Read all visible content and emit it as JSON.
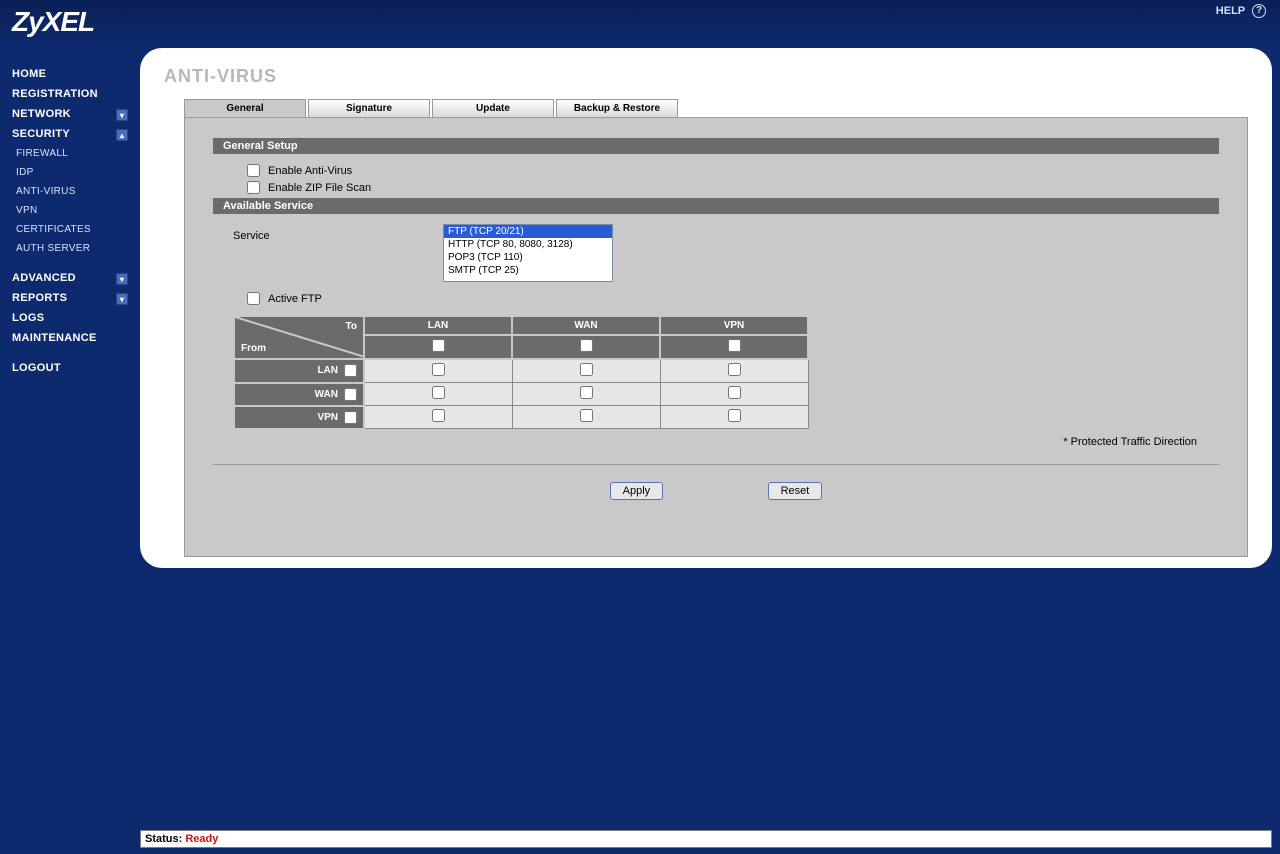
{
  "brand": "ZyXEL",
  "help_label": "HELP",
  "page_title": "ANTI-VIRUS",
  "nav": {
    "home": "HOME",
    "registration": "REGISTRATION",
    "network": "NETWORK",
    "security": "SECURITY",
    "firewall": "FIREWALL",
    "idp": "IDP",
    "antivirus": "ANTI-VIRUS",
    "vpn": "VPN",
    "certificates": "CERTIFICATES",
    "authserver": "AUTH SERVER",
    "advanced": "ADVANCED",
    "reports": "REPORTS",
    "logs": "LOGS",
    "maintenance": "MAINTENANCE",
    "logout": "LOGOUT"
  },
  "tabs": {
    "general": "General",
    "signature": "Signature",
    "update": "Update",
    "backup": "Backup & Restore"
  },
  "sections": {
    "general_setup": "General Setup",
    "available_service": "Available Service"
  },
  "checkboxes": {
    "enable_av": "Enable Anti-Virus",
    "enable_zip": "Enable ZIP File Scan",
    "active_ftp": "Active FTP"
  },
  "labels": {
    "service": "Service",
    "to": "To",
    "from": "From"
  },
  "services": {
    "ftp": "FTP (TCP 20/21)",
    "http": "HTTP (TCP 80, 8080, 3128)",
    "pop3": "POP3 (TCP 110)",
    "smtp": "SMTP (TCP 25)"
  },
  "zones": {
    "lan": "LAN",
    "wan": "WAN",
    "vpn": "VPN"
  },
  "note": "* Protected Traffic Direction",
  "buttons": {
    "apply": "Apply",
    "reset": "Reset"
  },
  "status": {
    "label": "Status:",
    "value": "Ready"
  }
}
